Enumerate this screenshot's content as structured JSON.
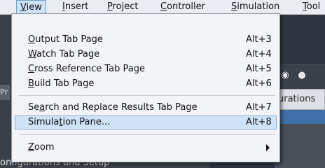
{
  "menubar": {
    "items": [
      {
        "label": "View",
        "underline": "V",
        "rest": "iew"
      },
      {
        "label": "Insert",
        "underline": "I",
        "rest": "nsert"
      },
      {
        "label": "Project",
        "underline": "P",
        "rest": "roject"
      },
      {
        "label": "Controller",
        "underline": "C",
        "rest": "ontroller"
      },
      {
        "label": "Simulation",
        "underline": "S",
        "rest": "imulation"
      },
      {
        "label": "Tool",
        "underline": "T",
        "rest": "ool"
      }
    ]
  },
  "view_menu": {
    "items": [
      {
        "underline": "O",
        "rest": "utput Tab Page",
        "shortcut": "Alt+3"
      },
      {
        "underline": "W",
        "rest": "atch Tab Page",
        "shortcut": "Alt+4"
      },
      {
        "underline": "C",
        "rest": "ross Reference Tab Page",
        "shortcut": "Alt+5"
      },
      {
        "underline": "B",
        "rest": "uild Tab Page",
        "shortcut": "Alt+6"
      },
      {
        "pre": "Se",
        "underline": "a",
        "rest": "rch and Replace Results Tab Page",
        "shortcut": "Alt+7"
      },
      {
        "pre": "Simula",
        "underline": "t",
        "rest": "ion Pane...",
        "shortcut": "Alt+8"
      },
      {
        "underline": "Z",
        "rest": "oom",
        "shortcut": ""
      }
    ]
  },
  "background": {
    "panel_header_text": "urations",
    "side_tab_text": "Pr",
    "bottom_text": "onfigurations and Setup"
  },
  "colors": {
    "menubar_bg": "#e9edf3",
    "highlight": "#cfe3f7",
    "highlight_border": "#7fb0de",
    "app_bg": "#2f3540"
  }
}
